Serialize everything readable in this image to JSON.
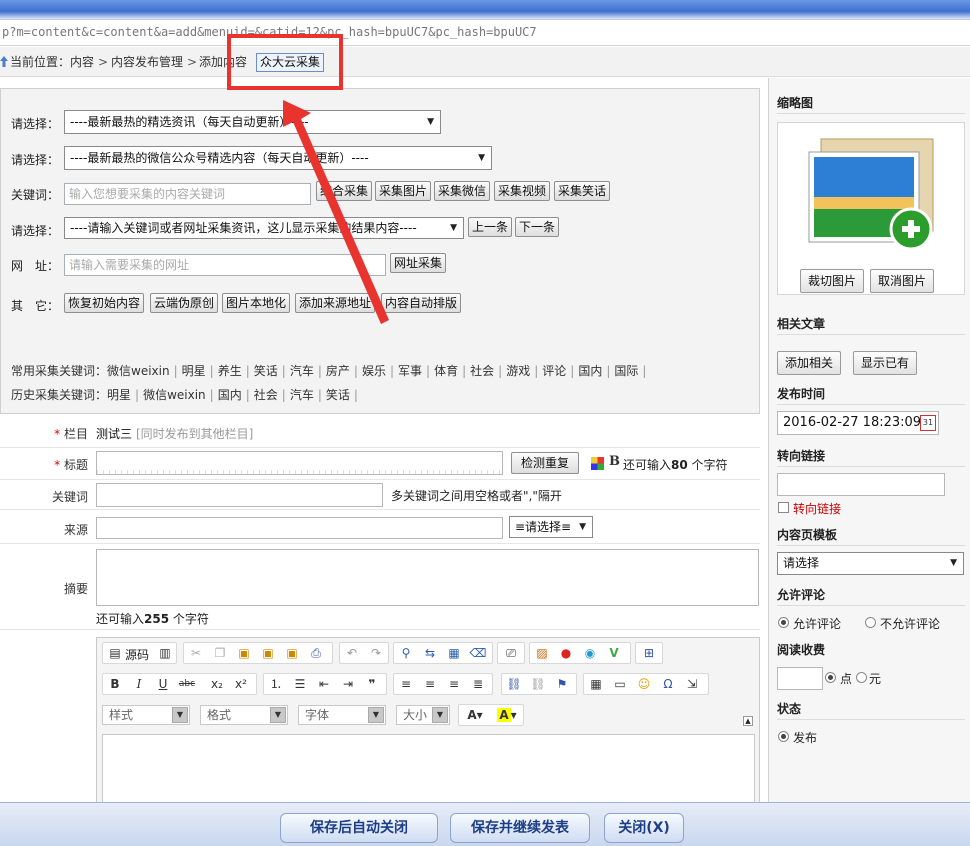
{
  "url": "p?m=content&c=content&a=add&menuid=&catid=12&pc_hash=bpuUC7&pc_hash=bpuUC7",
  "breadcrumb": {
    "prefix": "当前位置：",
    "items": [
      "内容",
      "内容发布管理",
      "添加内容"
    ],
    "sep": ">",
    "plugin_button": "众大云采集"
  },
  "collector": {
    "select1_label": "请选择：",
    "select1_value": "----最新最热的精选资讯（每天自动更新）----",
    "select2_label": "请选择：",
    "select2_value": "----最新最热的微信公众号精选内容（每天自动更新）----",
    "keyword_label": "关键词：",
    "keyword_placeholder": "输入您想要采集的内容关键词",
    "keyword_buttons": [
      "综合采集",
      "采集图片",
      "采集微信",
      "采集视频",
      "采集笑话"
    ],
    "select3_label": "请选择：",
    "select3_value": "----请输入关键词或者网址采集资讯，这儿显示采集的结果内容----",
    "prev_button": "上一条",
    "next_button": "下一条",
    "url_label": "网　址：",
    "url_placeholder": "请输入需要采集的网址",
    "url_button": "网址采集",
    "other_label": "其　它：",
    "other_buttons": [
      "恢复初始内容",
      "云端伪原创",
      "图片本地化",
      "添加来源地址",
      "内容自动排版"
    ],
    "common_kw_label": "常用采集关键词：",
    "common_kw": [
      "微信weixin",
      "明星",
      "养生",
      "笑话",
      "汽车",
      "房产",
      "娱乐",
      "军事",
      "体育",
      "社会",
      "游戏",
      "评论",
      "国内",
      "国际"
    ],
    "history_kw_label": "历史采集关键词：",
    "history_kw": [
      "明星",
      "微信weixin",
      "国内",
      "社会",
      "汽车",
      "笑话"
    ]
  },
  "form": {
    "column_label": "栏目",
    "column_value": "测试三",
    "column_sync": "[同时发布到其他栏目]",
    "title_label": "标题",
    "check_button": "检测重复",
    "title_hint_prefix": "还可输入",
    "title_hint_count": "80",
    "title_hint_suffix": "个字符",
    "keywords_label": "关键词",
    "keywords_hint": "多关键词之间用空格或者\",\"隔开",
    "source_label": "来源",
    "source_select": "≡请选择≡",
    "summary_label": "摘要",
    "summary_hint_prefix": "还可输入",
    "summary_hint_count": "255",
    "summary_hint_suffix": "个字符"
  },
  "editor": {
    "source_label": "源码",
    "style_combo": "样式",
    "format_combo": "格式",
    "font_combo": "字体",
    "size_combo": "大小"
  },
  "sidebar": {
    "thumb_title": "缩略图",
    "crop_button": "裁切图片",
    "cancel_button": "取消图片",
    "related_title": "相关文章",
    "add_related_button": "添加相关",
    "show_existing_button": "显示已有",
    "publish_time_title": "发布时间",
    "publish_time": "2016-02-27 18:23:09",
    "redirect_title": "转向链接",
    "redirect_check": "转向链接",
    "template_title": "内容页模板",
    "template_value": "请选择",
    "comment_title": "允许评论",
    "comment_on": "允许评论",
    "comment_off": "不允许评论",
    "fee_title": "阅读收费",
    "fee_point": "点",
    "fee_yuan": "元",
    "status_title": "状态",
    "status_value": "发布"
  },
  "bottom": {
    "save_close": "保存后自动关闭",
    "save_continue": "保存并继续发表",
    "close": "关闭(X)"
  },
  "colors": {
    "annotation": "#e8332e",
    "required": "#dd0000",
    "bottom_button_text": "#1c3e86"
  }
}
